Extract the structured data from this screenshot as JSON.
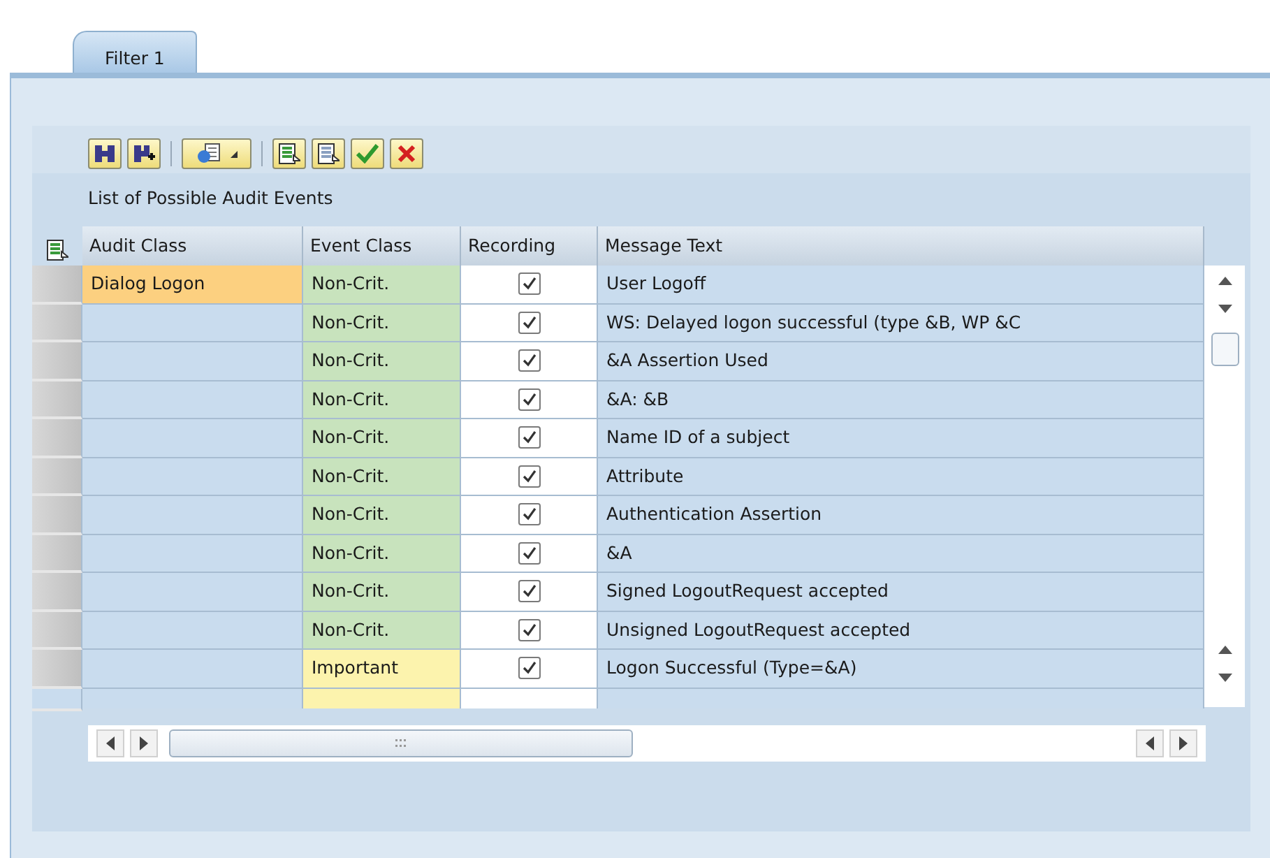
{
  "tabs": [
    {
      "label": "Filter 1",
      "selected": true
    }
  ],
  "table": {
    "title": "List of Possible Audit Events",
    "columns": [
      "Audit Class",
      "Event Class",
      "Recording",
      "Message Text"
    ],
    "rows": [
      {
        "audit_class": "Dialog Logon",
        "event_class": "Non-Crit.",
        "kind": "noncritical",
        "recording": true,
        "message": "User Logoff"
      },
      {
        "event_class": "Non-Crit.",
        "kind": "noncritical",
        "recording": true,
        "message": "WS: Delayed logon successful (type &B, WP &C"
      },
      {
        "event_class": "Non-Crit.",
        "kind": "noncritical",
        "recording": true,
        "message": "&A Assertion Used"
      },
      {
        "event_class": "Non-Crit.",
        "kind": "noncritical",
        "recording": true,
        "message": "&A: &B"
      },
      {
        "event_class": "Non-Crit.",
        "kind": "noncritical",
        "recording": true,
        "message": "Name ID of a subject"
      },
      {
        "event_class": "Non-Crit.",
        "kind": "noncritical",
        "recording": true,
        "message": "Attribute"
      },
      {
        "event_class": "Non-Crit.",
        "kind": "noncritical",
        "recording": true,
        "message": "Authentication Assertion"
      },
      {
        "event_class": "Non-Crit.",
        "kind": "noncritical",
        "recording": true,
        "message": "&A"
      },
      {
        "event_class": "Non-Crit.",
        "kind": "noncritical",
        "recording": true,
        "message": "Signed LogoutRequest accepted"
      },
      {
        "event_class": "Non-Crit.",
        "kind": "noncritical",
        "recording": true,
        "message": "Unsigned LogoutRequest accepted"
      },
      {
        "event_class": "Important",
        "kind": "important",
        "recording": true,
        "message": "Logon Successful (Type=&A)"
      }
    ]
  }
}
